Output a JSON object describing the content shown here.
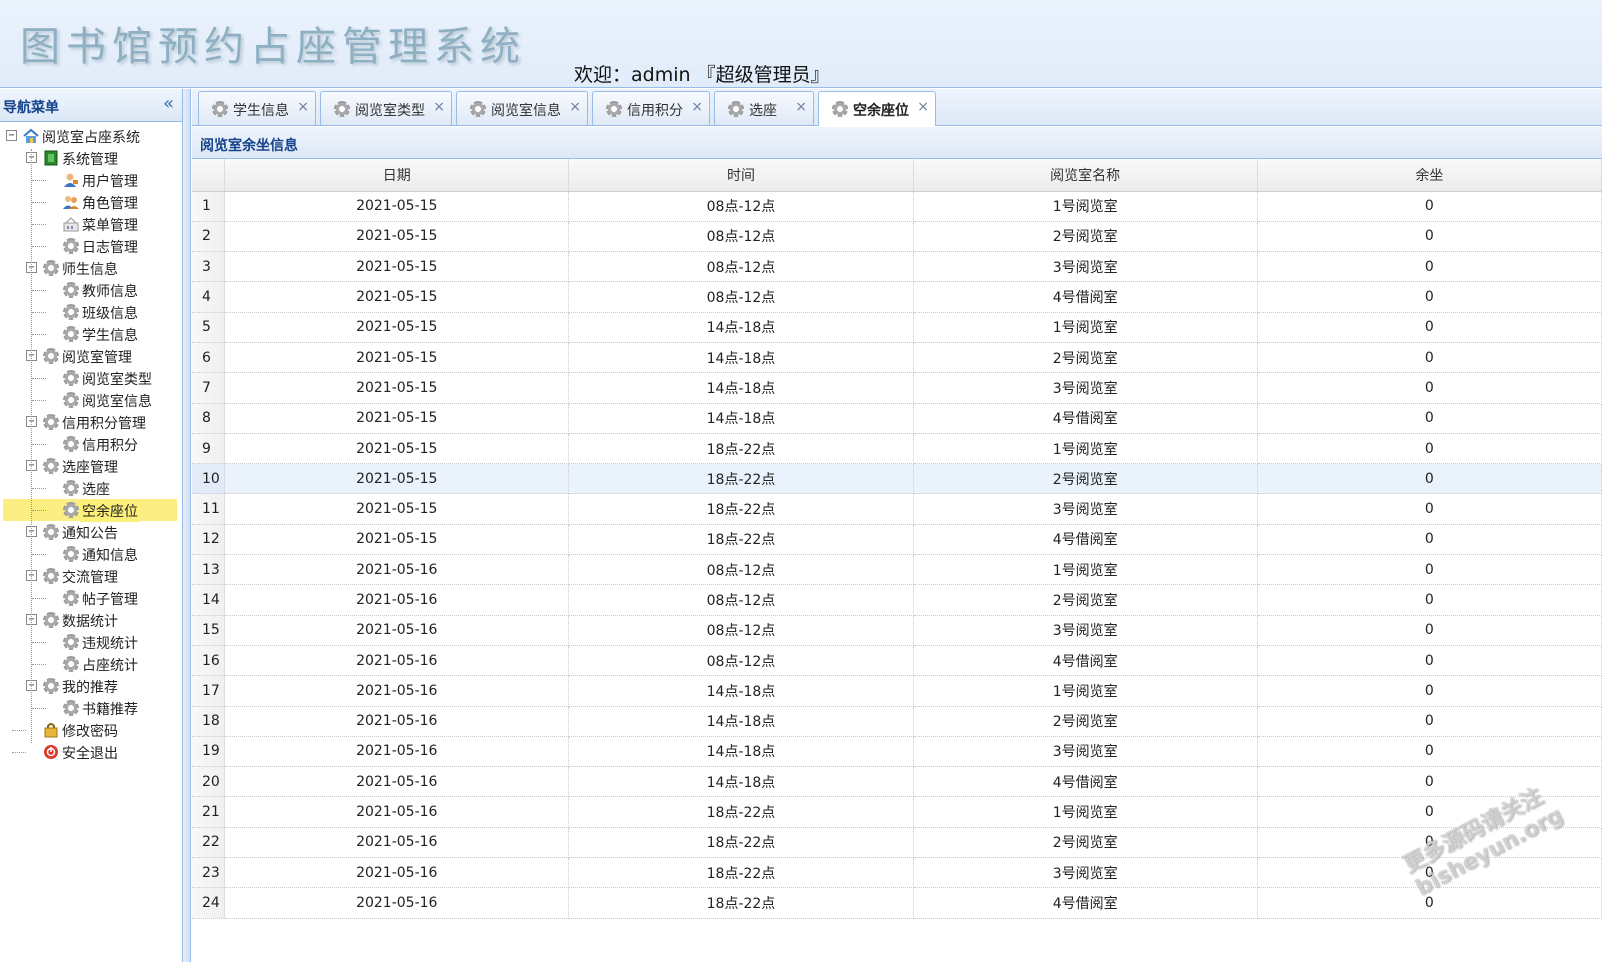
{
  "header": {
    "app_title": "图书馆预约占座管理系统",
    "welcome": "欢迎：admin 『超级管理员』"
  },
  "sidebar": {
    "title": "导航菜单",
    "collapse_glyph": "«",
    "tree": [
      {
        "label": "阅览室占座系统",
        "icon": "home-icon",
        "level": 0,
        "toggle": "−"
      },
      {
        "label": "系统管理",
        "icon": "folder-green-icon",
        "level": 1,
        "toggle": "−"
      },
      {
        "label": "用户管理",
        "icon": "user-icon",
        "level": 2
      },
      {
        "label": "角色管理",
        "icon": "users-icon",
        "level": 2
      },
      {
        "label": "菜单管理",
        "icon": "menu-icon",
        "level": 2
      },
      {
        "label": "日志管理",
        "icon": "gear-icon",
        "level": 2
      },
      {
        "label": "师生信息",
        "icon": "gear-icon",
        "level": 1,
        "toggle": "−"
      },
      {
        "label": "教师信息",
        "icon": "gear-icon",
        "level": 2
      },
      {
        "label": "班级信息",
        "icon": "gear-icon",
        "level": 2
      },
      {
        "label": "学生信息",
        "icon": "gear-icon",
        "level": 2
      },
      {
        "label": "阅览室管理",
        "icon": "gear-icon",
        "level": 1,
        "toggle": "−"
      },
      {
        "label": "阅览室类型",
        "icon": "gear-icon",
        "level": 2
      },
      {
        "label": "阅览室信息",
        "icon": "gear-icon",
        "level": 2
      },
      {
        "label": "信用积分管理",
        "icon": "gear-icon",
        "level": 1,
        "toggle": "−"
      },
      {
        "label": "信用积分",
        "icon": "gear-icon",
        "level": 2
      },
      {
        "label": "选座管理",
        "icon": "gear-icon",
        "level": 1,
        "toggle": "−"
      },
      {
        "label": "选座",
        "icon": "gear-icon",
        "level": 2
      },
      {
        "label": "空余座位",
        "icon": "gear-icon",
        "level": 2,
        "selected": true
      },
      {
        "label": "通知公告",
        "icon": "gear-icon",
        "level": 1,
        "toggle": "−"
      },
      {
        "label": "通知信息",
        "icon": "gear-icon",
        "level": 2
      },
      {
        "label": "交流管理",
        "icon": "gear-icon",
        "level": 1,
        "toggle": "−"
      },
      {
        "label": "帖子管理",
        "icon": "gear-icon",
        "level": 2
      },
      {
        "label": "数据统计",
        "icon": "gear-icon",
        "level": 1,
        "toggle": "−"
      },
      {
        "label": "违规统计",
        "icon": "gear-icon",
        "level": 2
      },
      {
        "label": "占座统计",
        "icon": "gear-icon",
        "level": 2
      },
      {
        "label": "我的推荐",
        "icon": "gear-icon",
        "level": 1,
        "toggle": "−"
      },
      {
        "label": "书籍推荐",
        "icon": "gear-icon",
        "level": 2
      },
      {
        "label": "修改密码",
        "icon": "lock-icon",
        "level": 1
      },
      {
        "label": "安全退出",
        "icon": "power-icon",
        "level": 1
      }
    ]
  },
  "tabs": [
    {
      "label": "学生信息",
      "active": false
    },
    {
      "label": "阅览室类型",
      "active": false
    },
    {
      "label": "阅览室信息",
      "active": false
    },
    {
      "label": "信用积分",
      "active": false
    },
    {
      "label": "选座",
      "active": false
    },
    {
      "label": "空余座位",
      "active": true
    }
  ],
  "tab_close_glyph": "×",
  "panel": {
    "title": "阅览室余坐信息",
    "columns": [
      "日期",
      "时间",
      "阅览室名称",
      "余坐"
    ],
    "rows": [
      [
        "1",
        "2021-05-15",
        "08点-12点",
        "1号阅览室",
        "0"
      ],
      [
        "2",
        "2021-05-15",
        "08点-12点",
        "2号阅览室",
        "0"
      ],
      [
        "3",
        "2021-05-15",
        "08点-12点",
        "3号阅览室",
        "0"
      ],
      [
        "4",
        "2021-05-15",
        "08点-12点",
        "4号借阅室",
        "0"
      ],
      [
        "5",
        "2021-05-15",
        "14点-18点",
        "1号阅览室",
        "0"
      ],
      [
        "6",
        "2021-05-15",
        "14点-18点",
        "2号阅览室",
        "0"
      ],
      [
        "7",
        "2021-05-15",
        "14点-18点",
        "3号阅览室",
        "0"
      ],
      [
        "8",
        "2021-05-15",
        "14点-18点",
        "4号借阅室",
        "0"
      ],
      [
        "9",
        "2021-05-15",
        "18点-22点",
        "1号阅览室",
        "0"
      ],
      [
        "10",
        "2021-05-15",
        "18点-22点",
        "2号阅览室",
        "0"
      ],
      [
        "11",
        "2021-05-15",
        "18点-22点",
        "3号阅览室",
        "0"
      ],
      [
        "12",
        "2021-05-15",
        "18点-22点",
        "4号借阅室",
        "0"
      ],
      [
        "13",
        "2021-05-16",
        "08点-12点",
        "1号阅览室",
        "0"
      ],
      [
        "14",
        "2021-05-16",
        "08点-12点",
        "2号阅览室",
        "0"
      ],
      [
        "15",
        "2021-05-16",
        "08点-12点",
        "3号阅览室",
        "0"
      ],
      [
        "16",
        "2021-05-16",
        "08点-12点",
        "4号借阅室",
        "0"
      ],
      [
        "17",
        "2021-05-16",
        "14点-18点",
        "1号阅览室",
        "0"
      ],
      [
        "18",
        "2021-05-16",
        "14点-18点",
        "2号阅览室",
        "0"
      ],
      [
        "19",
        "2021-05-16",
        "14点-18点",
        "3号阅览室",
        "0"
      ],
      [
        "20",
        "2021-05-16",
        "14点-18点",
        "4号借阅室",
        "0"
      ],
      [
        "21",
        "2021-05-16",
        "18点-22点",
        "1号阅览室",
        "0"
      ],
      [
        "22",
        "2021-05-16",
        "18点-22点",
        "2号阅览室",
        "0"
      ],
      [
        "23",
        "2021-05-16",
        "18点-22点",
        "3号阅览室",
        "0"
      ],
      [
        "24",
        "2021-05-16",
        "18点-22点",
        "4号借阅室",
        "0"
      ]
    ],
    "highlighted_row": 10
  },
  "watermark": {
    "line1": "更多源码请关注",
    "line2": "bisheyun.org"
  },
  "colors": {
    "accent": "#15428b",
    "border": "#99bbe8",
    "selected": "#fbee82"
  }
}
